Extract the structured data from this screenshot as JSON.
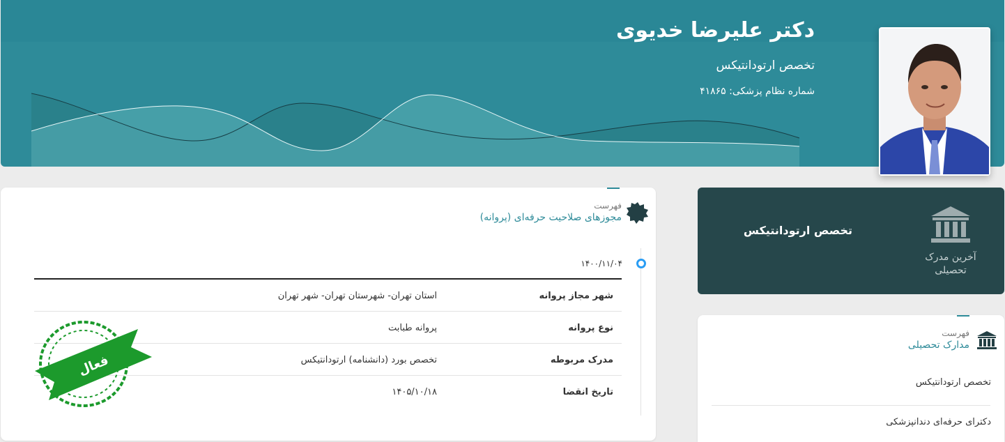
{
  "header": {
    "doctor_name": "دکتر علیرضا خدیوی",
    "specialty": "تخصص ارتودانتیکس",
    "medical_code": "شماره نظام پزشکی: ۴۱۸۶۵",
    "colors": {
      "header_bg": "#2e8b99",
      "dark_card": "#26474b",
      "accent": "#2e8b99",
      "stamp": "#1c9a2c"
    }
  },
  "licenses": {
    "list_label": "فهرست",
    "title": "مجوزهای صلاحیت حرفه‌ای (پروانه)",
    "date": "۱۴۰۰/۱۱/۰۴",
    "rows": [
      {
        "key": "شهر مجاز پروانه",
        "value": "استان تهران- شهرستان تهران- شهر تهران"
      },
      {
        "key": "نوع پروانه",
        "value": "پروانه طبابت"
      },
      {
        "key": "مدرک مربوطه",
        "value": "تخصص بورد (دانشنامه) ارتودانتیکس"
      },
      {
        "key": "تاریخ انقضا",
        "value": "۱۴۰۵/۱۰/۱۸"
      }
    ],
    "stamp_text": "فعال"
  },
  "latest_degree": {
    "title": "تخصص ارتودانتیکس",
    "caption": "آخرین مدرک تحصیلی"
  },
  "education": {
    "list_label": "فهرست",
    "title": "مدارک تحصیلی",
    "items": [
      "تخصص ارتودانتیکس",
      "دکترای حرفه‌ای دندانپزشکی"
    ]
  }
}
